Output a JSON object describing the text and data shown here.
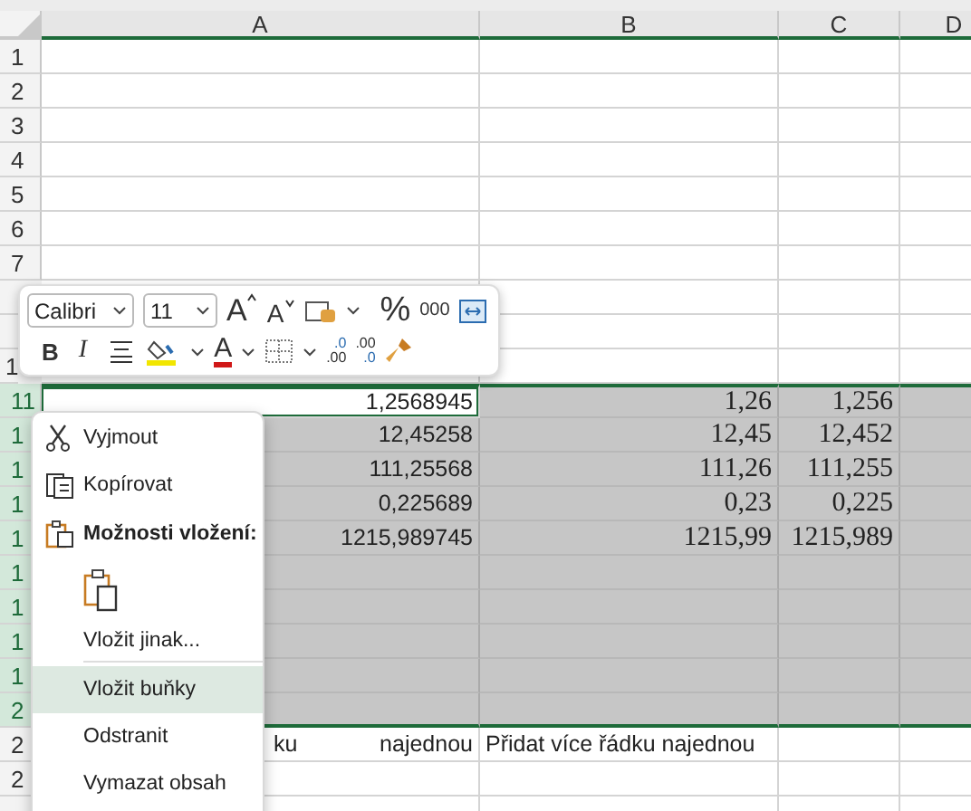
{
  "columns": [
    {
      "label": "A"
    },
    {
      "label": "B"
    },
    {
      "label": "C"
    },
    {
      "label": "D"
    }
  ],
  "rows": [
    {
      "label": "1",
      "selected": false
    },
    {
      "label": "2",
      "selected": false
    },
    {
      "label": "3",
      "selected": false
    },
    {
      "label": "4",
      "selected": false
    },
    {
      "label": "5",
      "selected": false
    },
    {
      "label": "6",
      "selected": false
    },
    {
      "label": "7",
      "selected": false
    },
    {
      "selected": false
    },
    {
      "selected": false
    },
    {
      "label": "1",
      "selected": false
    },
    {
      "label": "11",
      "selected": true,
      "active": true,
      "a": "1,2568945",
      "b": "1,26",
      "c": "1,256"
    },
    {
      "label": "1",
      "selected": true,
      "a": "12,45258",
      "b": "12,45",
      "c": "12,452"
    },
    {
      "label": "1",
      "selected": true,
      "a": "111,25568",
      "b": "111,26",
      "c": "111,255"
    },
    {
      "label": "1",
      "selected": true,
      "a": "0,225689",
      "b": "0,23",
      "c": "0,225"
    },
    {
      "label": "1",
      "selected": true,
      "a": "1215,989745",
      "b": "1215,99",
      "c": "1215,989"
    },
    {
      "label": "1",
      "selected": true
    },
    {
      "label": "1",
      "selected": true
    },
    {
      "label": "1",
      "selected": true
    },
    {
      "label": "1",
      "selected": true
    },
    {
      "label": "2",
      "selected": true
    },
    {
      "label": "2",
      "selected": false,
      "a_parts": [
        "ku",
        "najednou"
      ],
      "b_text": "Přidat více řádku najednou"
    },
    {
      "label": "2",
      "selected": false
    },
    {
      "selected": false
    }
  ],
  "mini_toolbar": {
    "font": "Calibri",
    "size": "11",
    "grow": "A",
    "shrink": "A",
    "percent": "%",
    "thousands": "000",
    "bold": "B",
    "italic": "I",
    "font_color": "A",
    "dec_decrease": [
      ".0",
      ".00"
    ],
    "dec_increase": [
      ".00",
      ".0"
    ]
  },
  "context_menu": [
    {
      "kind": "command",
      "label": "Vyjmout",
      "selected": false
    },
    {
      "kind": "command",
      "label": "Kopírovat",
      "selected": false
    },
    {
      "kind": "heading",
      "label": "Možnosti vložení:"
    },
    {
      "kind": "paste-option",
      "selected": false
    },
    {
      "kind": "command",
      "label": "Vložit jinak...",
      "selected": false
    },
    {
      "kind": "separator"
    },
    {
      "kind": "command",
      "label": "Vložit buňky",
      "selected": true
    },
    {
      "kind": "command",
      "label": "Odstranit",
      "selected": false
    },
    {
      "kind": "command",
      "label": "Vymazat obsah",
      "selected": false
    }
  ]
}
